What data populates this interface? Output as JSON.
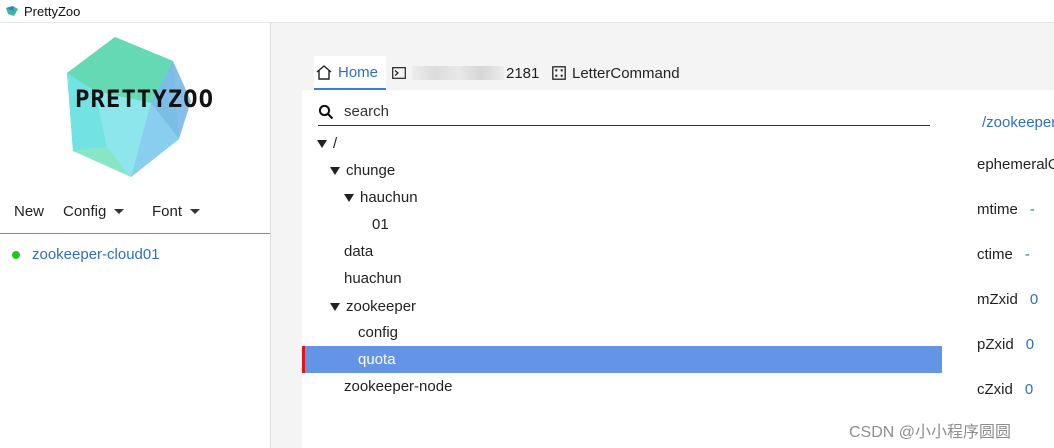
{
  "window": {
    "title": "PrettyZoo"
  },
  "logo": {
    "text": "PRETTYZOO"
  },
  "menu": {
    "new": "New",
    "config": "Config",
    "font": "Font"
  },
  "servers": [
    {
      "name": "zookeeper-cloud01",
      "status_color": "#22c322"
    }
  ],
  "tabs": [
    {
      "label": "Home",
      "icon": "home-icon",
      "active": true
    },
    {
      "label": "2181",
      "icon": "terminal-icon",
      "active": false
    },
    {
      "label": "LetterCommand",
      "icon": "command-icon",
      "active": false
    }
  ],
  "search": {
    "placeholder": "search"
  },
  "tree": [
    {
      "label": "/",
      "expanded": true
    },
    {
      "label": "chunge",
      "expanded": true
    },
    {
      "label": "hauchun",
      "expanded": true
    },
    {
      "label": "01"
    },
    {
      "label": "data"
    },
    {
      "label": "huachun"
    },
    {
      "label": "zookeeper",
      "expanded": true
    },
    {
      "label": "config"
    },
    {
      "label": "quota",
      "selected": true
    },
    {
      "label": "zookeeper-node"
    }
  ],
  "details": {
    "path": "/zookeeper/quota",
    "ephemeral_label": "ephemeralOwner",
    "mtime_label": "mtime",
    "mtime_value": "-",
    "ctime_label": "ctime",
    "ctime_value": "-",
    "mzxid_label": "mZxid",
    "mzxid_value": "0",
    "pzxid_label": "pZxid",
    "pzxid_value": "0",
    "czxid_label": "cZxid",
    "czxid_value": "0"
  },
  "watermark": "CSDN @小小程序圆圆",
  "colors": {
    "accent": "#2e6fc6",
    "selected_row": "#6394e6",
    "selection_marker": "#e0161c"
  }
}
